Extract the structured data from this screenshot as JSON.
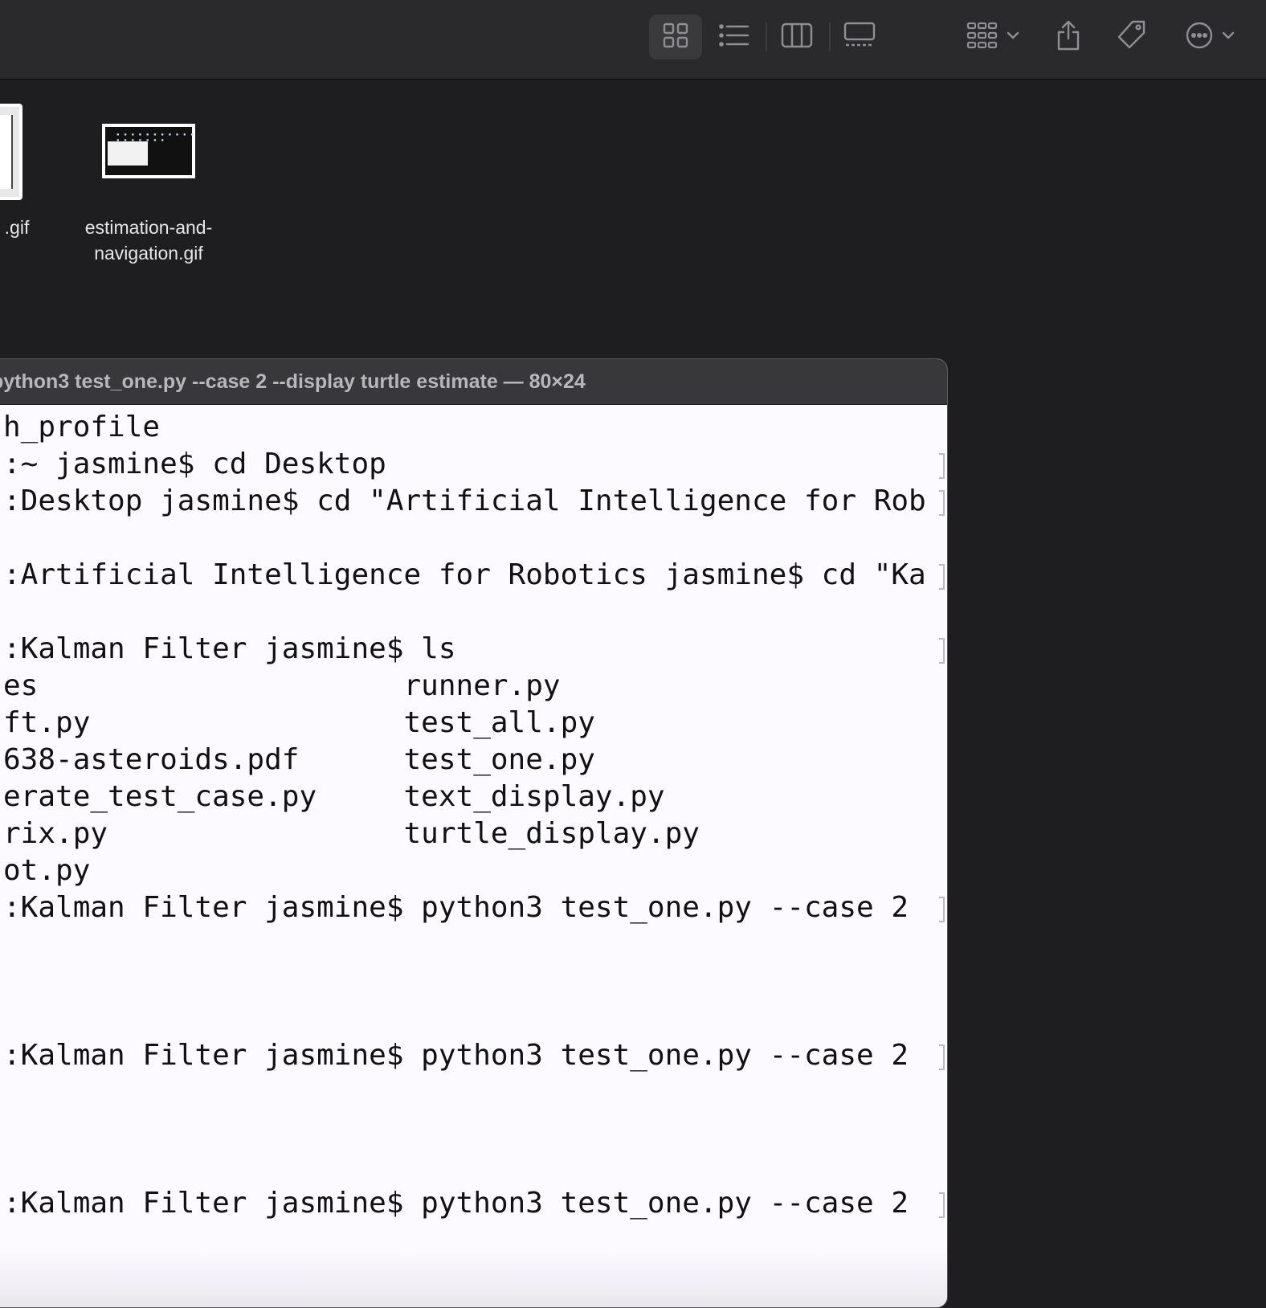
{
  "toolbar": {
    "view_icons": [
      "icon-view-icon",
      "list-view-icon",
      "column-view-icon",
      "gallery-view-icon"
    ],
    "group_icon": "group-icon",
    "share_icon": "share-icon",
    "tag_icon": "tag-icon",
    "more_icon": "more-icon",
    "colors": {
      "background": "#2a2a2c",
      "icon": "#8e8e93",
      "active_bg": "#3a3a3d"
    }
  },
  "files": [
    {
      "name": ".gif"
    },
    {
      "name_line1": "estimation-and-",
      "name_line2": "navigation.gif"
    }
  ],
  "terminal": {
    "title": "python3 test_one.py --case 2 --display turtle estimate — 80×24",
    "lines": [
      "h_profile",
      ":~ jasmine$ cd Desktop",
      ":Desktop jasmine$ cd \"Artificial Intelligence for Rob",
      ":Artificial Intelligence for Robotics jasmine$ cd \"Ka",
      ":Kalman Filter jasmine$ ls",
      "es                     runner.py",
      "ft.py                  test_all.py",
      "638-asteroids.pdf      test_one.py",
      "erate_test_case.py     text_display.py",
      "rix.py                 turtle_display.py",
      "ot.py",
      ":Kalman Filter jasmine$ python3 test_one.py --case 2",
      ":Kalman Filter jasmine$ python3 test_one.py --case 2",
      ":Kalman Filter jasmine$ python3 test_one.py --case 2"
    ]
  }
}
